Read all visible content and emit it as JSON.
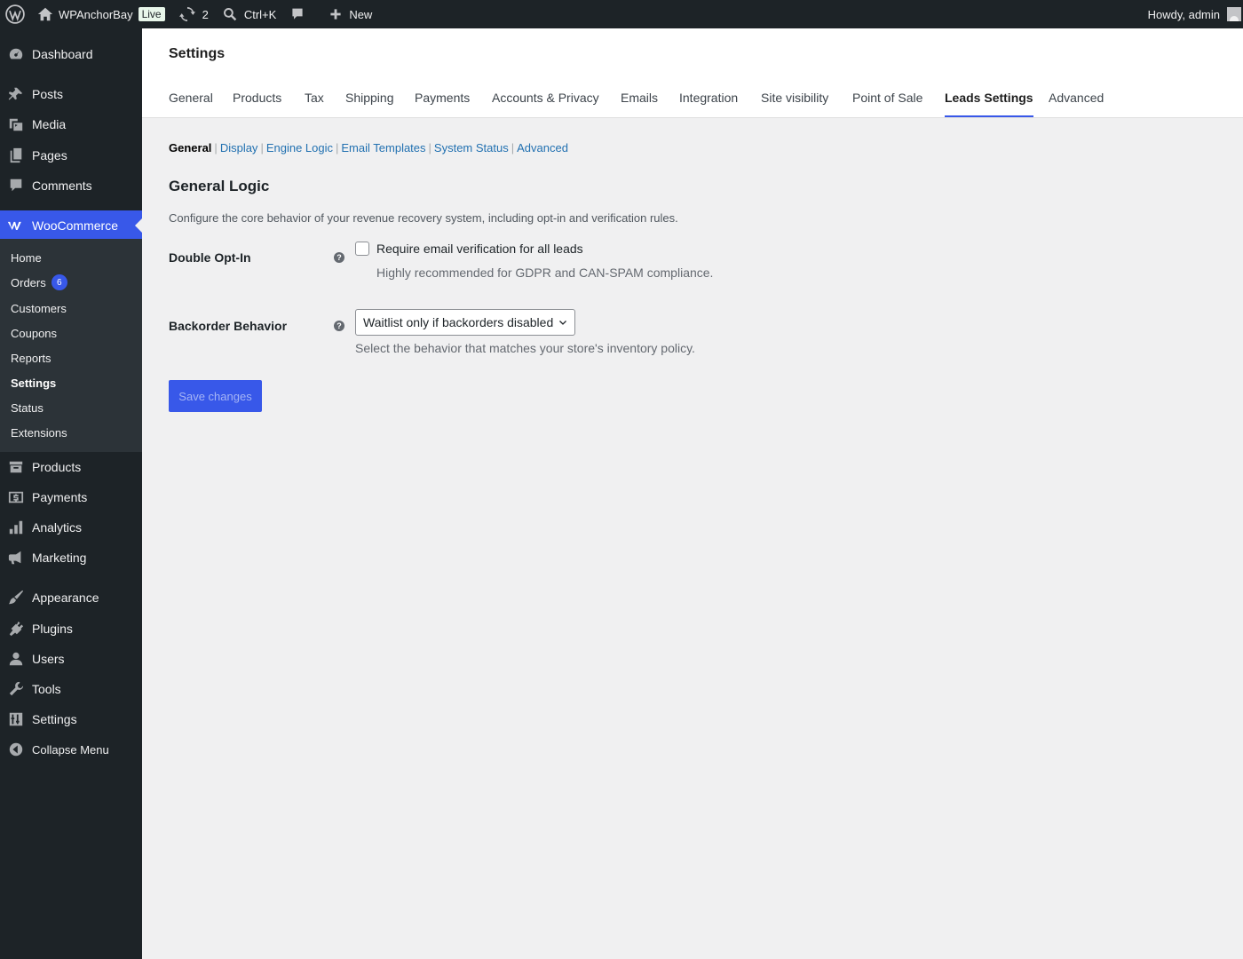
{
  "adminbar": {
    "site_name": "WPAnchorBay",
    "live_badge": "Live",
    "updates_count": "2",
    "search_shortcut": "Ctrl+K",
    "new_label": "New",
    "howdy": "Howdy, admin"
  },
  "sidebar": {
    "items": [
      {
        "label": "Dashboard",
        "icon": "dashboard-icon"
      },
      {
        "label": "Posts",
        "icon": "pin-icon"
      },
      {
        "label": "Media",
        "icon": "media-icon"
      },
      {
        "label": "Pages",
        "icon": "pages-icon"
      },
      {
        "label": "Comments",
        "icon": "comment-icon"
      },
      {
        "label": "WooCommerce",
        "icon": "woo-icon"
      },
      {
        "label": "Products",
        "icon": "archive-icon"
      },
      {
        "label": "Payments",
        "icon": "dollar-icon"
      },
      {
        "label": "Analytics",
        "icon": "chart-bar-icon"
      },
      {
        "label": "Marketing",
        "icon": "megaphone-icon"
      },
      {
        "label": "Appearance",
        "icon": "brush-icon"
      },
      {
        "label": "Plugins",
        "icon": "plugin-icon"
      },
      {
        "label": "Users",
        "icon": "user-icon"
      },
      {
        "label": "Tools",
        "icon": "wrench-icon"
      },
      {
        "label": "Settings",
        "icon": "sliders-icon"
      },
      {
        "label": "Collapse Menu",
        "icon": "collapse-icon"
      }
    ],
    "submenu": [
      {
        "label": "Home"
      },
      {
        "label": "Orders",
        "badge": "6"
      },
      {
        "label": "Customers"
      },
      {
        "label": "Coupons"
      },
      {
        "label": "Reports"
      },
      {
        "label": "Settings"
      },
      {
        "label": "Status"
      },
      {
        "label": "Extensions"
      }
    ]
  },
  "header": {
    "title": "Settings",
    "tabs": [
      "General",
      "Products",
      "Tax",
      "Shipping",
      "Payments",
      "Accounts & Privacy",
      "Emails",
      "Integration",
      "Site visibility",
      "Point of Sale",
      "Leads Settings",
      "Advanced"
    ],
    "active_tab": "Leads Settings"
  },
  "subnav": {
    "items": [
      "General",
      "Display",
      "Engine Logic",
      "Email Templates",
      "System Status",
      "Advanced"
    ],
    "separator": "|",
    "active": "General"
  },
  "section": {
    "title": "General Logic",
    "description": "Configure the core behavior of your revenue recovery system, including opt-in and verification rules."
  },
  "fields": {
    "double_optin": {
      "label": "Double Opt-In",
      "checkbox_label": "Require email verification for all leads",
      "checked": false,
      "description": "Highly recommended for GDPR and CAN-SPAM compliance."
    },
    "backorder": {
      "label": "Backorder Behavior",
      "selected": "Waitlist only if backorders disabled",
      "description": "Select the behavior that matches your store's inventory policy."
    },
    "help_glyph": "?"
  },
  "save_label": "Save changes",
  "colors": {
    "admin_bar": "#1d2327",
    "accent": "#3858e9",
    "link": "#2271b1",
    "background": "#f0f0f1"
  }
}
